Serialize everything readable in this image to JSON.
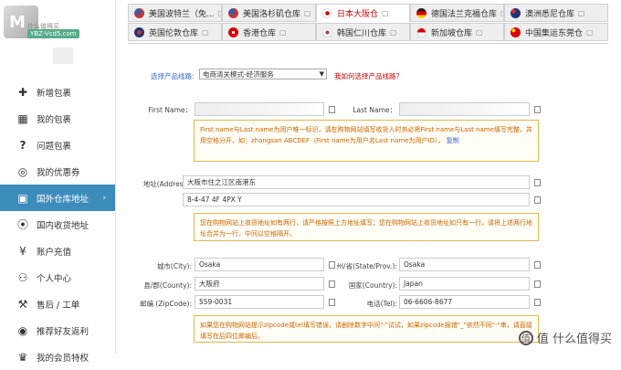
{
  "logo": {
    "caption": "YBZ-Vcd5.com",
    "caption2": "什么值得买"
  },
  "sidebar": {
    "items": [
      {
        "label": "新增包裹",
        "icon": "plus-icon"
      },
      {
        "label": "我的包裹",
        "icon": "package-icon"
      },
      {
        "label": "问题包裹",
        "icon": "question-icon"
      },
      {
        "label": "我的优惠券",
        "icon": "coupon-icon"
      },
      {
        "label": "国外仓库地址",
        "icon": "folder-icon",
        "active": true
      },
      {
        "label": "国内收货地址",
        "icon": "location-icon"
      },
      {
        "label": "账户充值",
        "icon": "yen-icon"
      },
      {
        "label": "个人中心",
        "icon": "user-icon"
      },
      {
        "label": "售后 / 工单",
        "icon": "wrench-icon"
      },
      {
        "label": "推荐好友返利",
        "icon": "share-icon"
      },
      {
        "label": "我的会员特权",
        "icon": "vip-icon"
      }
    ]
  },
  "tabs": [
    {
      "label": "美国波特兰（免...",
      "flag": "us"
    },
    {
      "label": "美国洛杉矶仓库",
      "flag": "us"
    },
    {
      "label": "日本大阪仓",
      "flag": "jp",
      "active": true
    },
    {
      "label": "德国法兰克福仓库",
      "flag": "de"
    },
    {
      "label": "澳洲悉尼仓库",
      "flag": "au"
    },
    {
      "label": "英国伦敦仓库",
      "flag": "uk"
    },
    {
      "label": "香港仓库",
      "flag": "hk"
    },
    {
      "label": "韩国仁川仓库",
      "flag": "kr"
    },
    {
      "label": "新加坡仓库",
      "flag": "sg"
    },
    {
      "label": "中国集运东莞仓",
      "flag": "cn"
    }
  ],
  "form": {
    "line_label": "选择产品线路:",
    "line_value": "电商清关模式-经济服务",
    "help_link": "我如何选择产品线路？",
    "first_name_label": "First Name：",
    "last_name_label": "Last Name：",
    "name_note": "First name与Last name为用户唯一标识，请在购物网站填写收货人时务必将First name与Last name填写完整，并用空格分开，如：zhangsan ABCDEF（First name为用户名Last name为用户ID）。",
    "name_note_link": "复制",
    "address_label": "地址(Address):",
    "address_line1": "大阪市住之江区南港东",
    "address_line2": "8-4-47 4F 4PX Y",
    "address_note": "您在购物网站上收货地址如有两行，请严格按照上方地址填写；您在购物网站上收货地址如只有一行，请将上述两行地址合并为一行，中间以空格隔开。",
    "city_label": "城市(City):",
    "city_value": "Osaka",
    "state_label": "州/省(State/Prov.):",
    "state_value": "Osaka",
    "county_label": "县/郡(County):",
    "county_value": "大阪府",
    "country_label": "国家(Country):",
    "country_value": "Japan",
    "zip_label": "邮编 (ZipCode):",
    "zip_value": "559-0031",
    "tel_label": "电话(Tel):",
    "tel_value": "06-6606-8677",
    "zip_note": "如果您在购物网站提示zipcode或tel填写错误，请删除数字中间\"-\"试试，如果zipcode报错\"_\"依然不同\"-\"串，请直接填写在后四位邮编后。"
  },
  "watermark": "值 什么值得买"
}
